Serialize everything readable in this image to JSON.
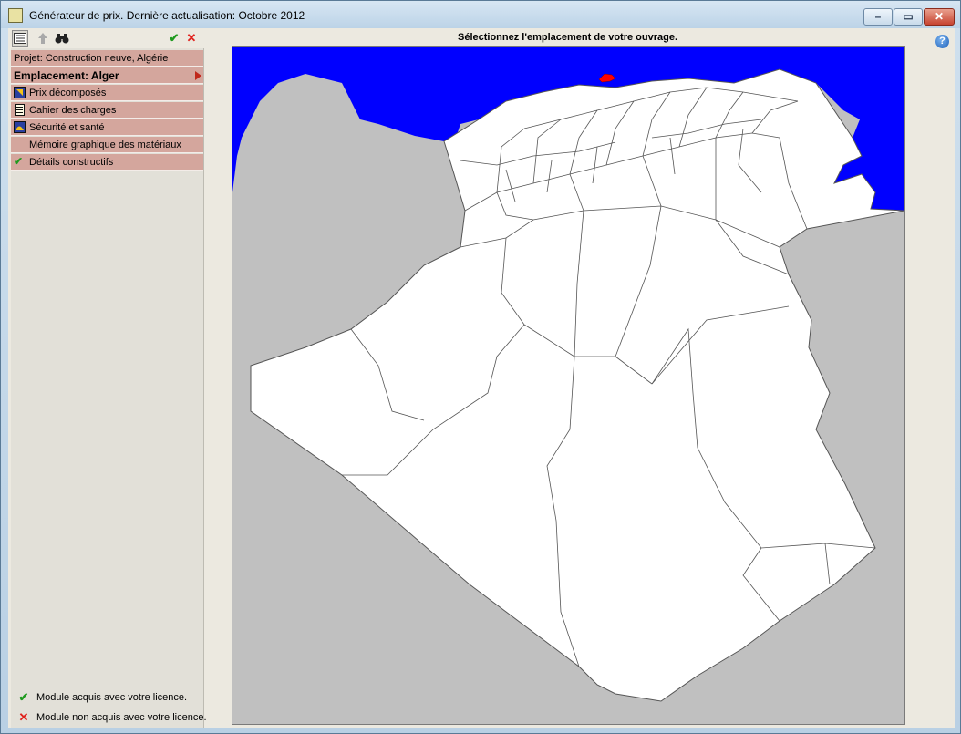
{
  "window": {
    "title": "Générateur de prix. Dernière actualisation: Octobre 2012",
    "minimize_glyph": "–",
    "maximize_glyph": "▭",
    "close_glyph": "✕"
  },
  "toolbar": {
    "check_glyph": "✔",
    "cross_glyph": "✕"
  },
  "sidebar": {
    "project": "Projet: Construction neuve, Algérie",
    "location": "Emplacement: Alger",
    "items": [
      {
        "label": "Prix décomposés",
        "icon": "price-icon"
      },
      {
        "label": "Cahier des charges",
        "icon": "document-icon"
      },
      {
        "label": "Sécurité et santé",
        "icon": "helmet-icon"
      },
      {
        "label": "Mémoire graphique des matériaux",
        "icon": ""
      },
      {
        "label": "Détails constructifs",
        "icon": "check-icon"
      }
    ]
  },
  "legend": [
    {
      "mark": "✔",
      "text": "Module acquis avec votre licence."
    },
    {
      "mark": "✕",
      "text": "Module non acquis avec votre licence."
    }
  ],
  "map": {
    "title": "Sélectionnez l'emplacement de votre ouvrage.",
    "selected_region": "Alger",
    "colors": {
      "sea": "#0000ff",
      "land": "#ffffff",
      "outside": "#c0c0c0",
      "selected": "#ff0000",
      "border": "#7a7a7a"
    }
  },
  "help": {
    "glyph": "?"
  },
  "colors": {
    "menu_bg": "#d4a69d",
    "check_green": "#1f9a1f",
    "cross_red": "#e0201b"
  }
}
